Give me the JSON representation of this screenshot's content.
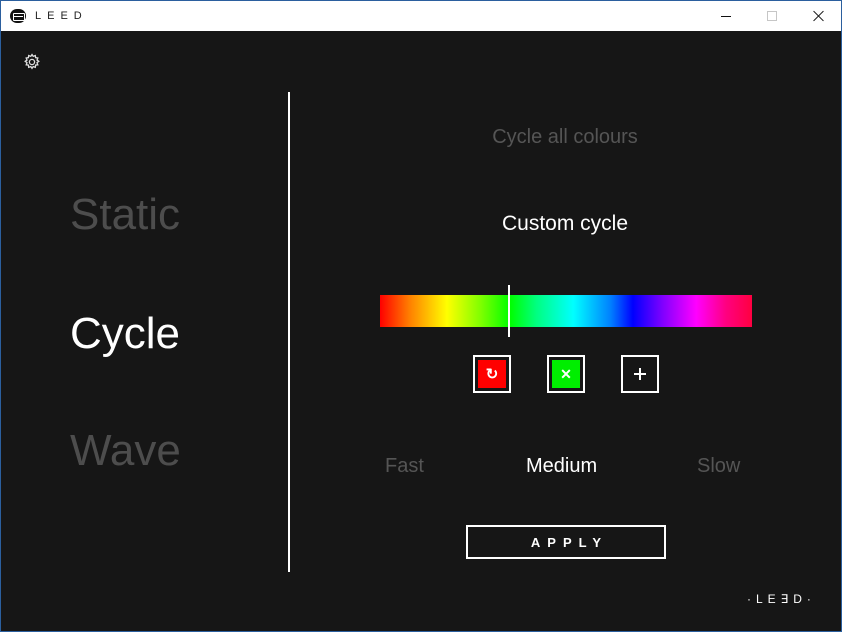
{
  "titlebar": {
    "title": "LEED"
  },
  "icons": {
    "app": "leed-logo-icon",
    "settings": "gear-icon",
    "minimize": "minimize-icon",
    "maximize": "maximize-icon",
    "close": "close-icon"
  },
  "modes": {
    "static": "Static",
    "cycle": "Cycle",
    "wave": "Wave",
    "selected": "Cycle"
  },
  "cycle_options": {
    "all": "Cycle all colours",
    "custom": "Custom cycle",
    "selected": "Custom cycle"
  },
  "colour_controls": {
    "red_symbol": "↻",
    "green_symbol": "✕",
    "red_color": "#ff0000",
    "green_color": "#00ee00"
  },
  "speed": {
    "fast": "Fast",
    "medium": "Medium",
    "slow": "Slow",
    "selected": "Medium"
  },
  "apply_label": "APPLY",
  "brand_footer": "·LE∃D·",
  "colors": {
    "background": "#161616",
    "active_text": "#ffffff",
    "inactive_text": "#555555"
  }
}
